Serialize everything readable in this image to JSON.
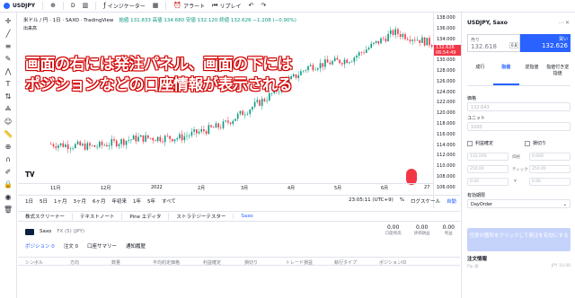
{
  "topbar": {
    "symbol": "USDJPY",
    "indicators": "インジケーター",
    "alert": "アラート",
    "replay": "リプレイ"
  },
  "chart": {
    "title": "米ドル / 円 · 1日 · SAXO · TradingView",
    "ohlc": "始値 131.833  高値 134.680  安値 132.120  終値 132.626  −1.208 (−0.90%)",
    "volume_label": "出来高"
  },
  "annotation": {
    "line1": "画面の右には発注パネル、画面の下には",
    "line2": "ポジションなどの口座情報が表示される"
  },
  "price_axis": {
    "ticks": [
      "138.000",
      "136.000",
      "134.000",
      "132.000",
      "130.000",
      "128.000",
      "126.000",
      "124.000",
      "122.000",
      "120.000",
      "118.000",
      "116.000",
      "114.000",
      "112.000",
      "110.000",
      "108.000",
      "106.000"
    ],
    "current_price": "132.626",
    "countdown": "06:54:49",
    "tag_label": "USDJPY"
  },
  "time_axis": {
    "labels": [
      "11月",
      "12月",
      "2022",
      "2月",
      "3月",
      "4月",
      "5月",
      "6月",
      "27"
    ]
  },
  "range_bar": {
    "ranges": [
      "1日",
      "5日",
      "1ヶ月",
      "3ヶ月",
      "6ヶ月",
      "年初来",
      "1年",
      "5年",
      "すべて"
    ],
    "clock": "23:05:11 (UTC+9)",
    "percent": "%",
    "log": "ログスケール",
    "auto": "自動"
  },
  "bottom_tabs": [
    "株式スクリーナー",
    "テキストノート",
    "Pine エディタ",
    "ストラテジーテスター",
    "Saxo"
  ],
  "account": {
    "broker": "Saxo",
    "currency": "FX (5) (JPY)",
    "values": [
      {
        "num": "0.00",
        "label": "口座残高"
      },
      {
        "num": "0.00",
        "label": "評価損益"
      },
      {
        "num": "0.00",
        "label": "利益"
      }
    ]
  },
  "position_tabs": [
    "ポジション 0",
    "注文 0",
    "口座サマリー",
    "通知履歴"
  ],
  "position_columns": [
    "シンボル",
    "方向",
    "数量",
    "平均約定価格",
    "利益確定",
    "損切り",
    "トレード損益",
    "執行タイプ",
    "ポジションID"
  ],
  "order_panel": {
    "title": "USDJPY, Saxo",
    "sell_label": "売り",
    "sell_price": "132.618",
    "buy_label": "買い",
    "buy_price": "132.626",
    "spread": "0.8",
    "tabs": [
      "成行",
      "指値",
      "逆指値",
      "指値付き逆指値"
    ],
    "price_label": "価格",
    "price_placeholder": "132.643",
    "unit_label": "ユニット",
    "unit_placeholder": "1000",
    "tp_label": "利益確定",
    "sl_label": "損切り",
    "tp_cols": [
      "132.000",
      "250.00",
      "0.00"
    ],
    "sl_cols": [
      "0.000",
      "250.00",
      "0.00"
    ],
    "col_price": "価格",
    "col_pips": "ティック",
    "col_yen": "¥",
    "validity_label": "有効期限",
    "validity_value": "DayOrder",
    "submit_label": "任意の箇所をクリックして発注を有効にする",
    "order_info": "注文情報",
    "pip_row_left": "Pip 値",
    "pip_row_right": "JPY 10.00"
  },
  "chart_data": {
    "type": "candlestick",
    "x": [
      "11月",
      "12月",
      "2022",
      "2月",
      "3月",
      "4月",
      "5月",
      "6月"
    ],
    "close": [
      114.0,
      113.5,
      115.1,
      115.2,
      117.5,
      122.5,
      128.5,
      130.0,
      135.0,
      132.6
    ],
    "ylim": [
      106,
      138
    ]
  }
}
